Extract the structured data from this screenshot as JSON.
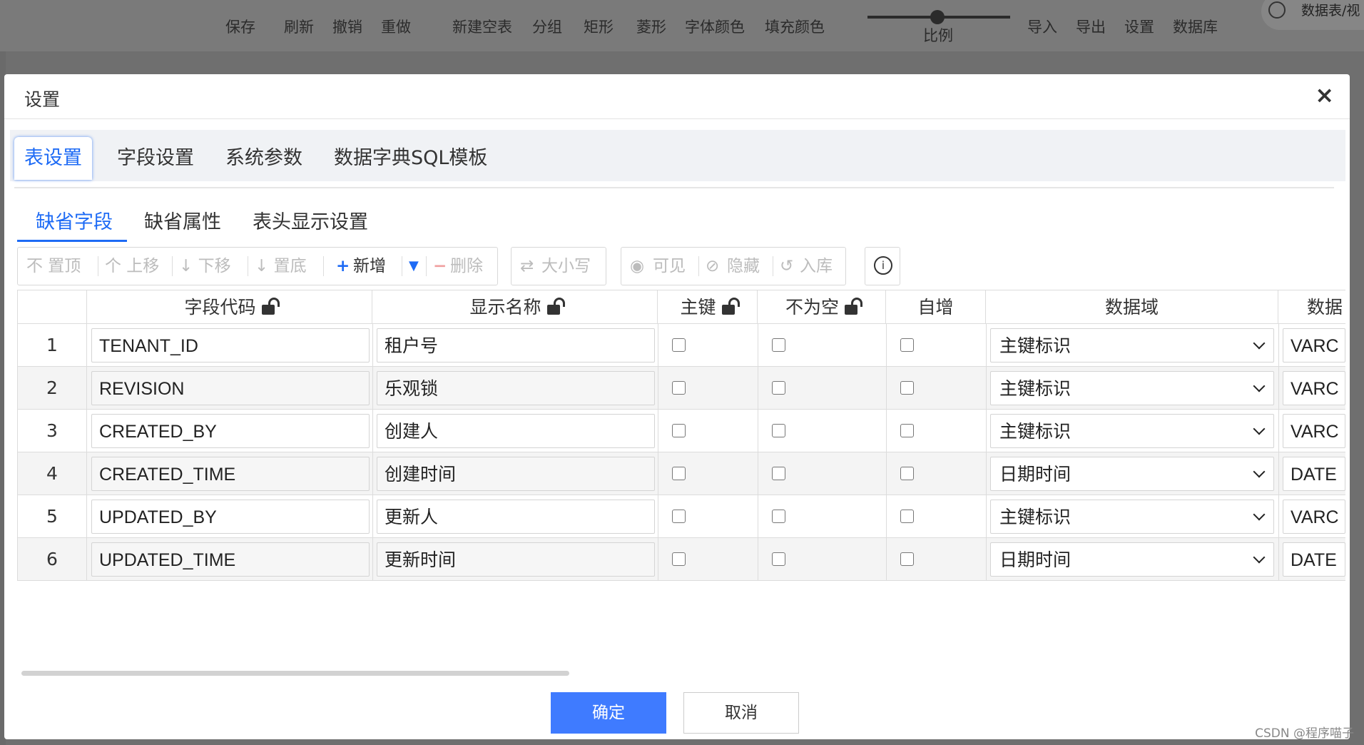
{
  "toolbar": {
    "items": [
      "保存",
      "刷新",
      "撤销",
      "重做",
      "新建空表",
      "分组",
      "矩形",
      "菱形",
      "字体颜色",
      "填充颜色",
      "比例",
      "导入",
      "导出",
      "设置",
      "数据库"
    ],
    "search_text": "数据表/视"
  },
  "dialog": {
    "title": "设置",
    "close": "×",
    "tabs": [
      "表设置",
      "字段设置",
      "系统参数",
      "数据字典SQL模板"
    ],
    "subtabs": [
      "缺省字段",
      "缺省属性",
      "表头显示设置"
    ],
    "actions": {
      "top": "不 置顶",
      "up": "个 上移",
      "down": "↓ 下移",
      "bottom": "↓ 置底",
      "add": "新增",
      "delete": "删除",
      "case": "大小写",
      "visible": "可见",
      "hidden": "隐藏",
      "store": "入库",
      "info": "i"
    },
    "columns": [
      "字段代码",
      "显示名称",
      "主键",
      "不为空",
      "自增",
      "数据域",
      "数据"
    ],
    "rows": [
      {
        "num": "1",
        "code": "TENANT_ID",
        "name": "租户号",
        "domain": "主键标识",
        "type": "VARC"
      },
      {
        "num": "2",
        "code": "REVISION",
        "name": "乐观锁",
        "domain": "主键标识",
        "type": "VARC"
      },
      {
        "num": "3",
        "code": "CREATED_BY",
        "name": "创建人",
        "domain": "主键标识",
        "type": "VARC"
      },
      {
        "num": "4",
        "code": "CREATED_TIME",
        "name": "创建时间",
        "domain": "日期时间",
        "type": "DATE"
      },
      {
        "num": "5",
        "code": "UPDATED_BY",
        "name": "更新人",
        "domain": "主键标识",
        "type": "VARC"
      },
      {
        "num": "6",
        "code": "UPDATED_TIME",
        "name": "更新时间",
        "domain": "日期时间",
        "type": "DATE"
      }
    ],
    "ok": "确定",
    "cancel": "取消"
  },
  "watermark": "CSDN @程序喵子",
  "colors": {
    "accent": "#1e6bf5",
    "ok_button": "#3f7bff"
  }
}
